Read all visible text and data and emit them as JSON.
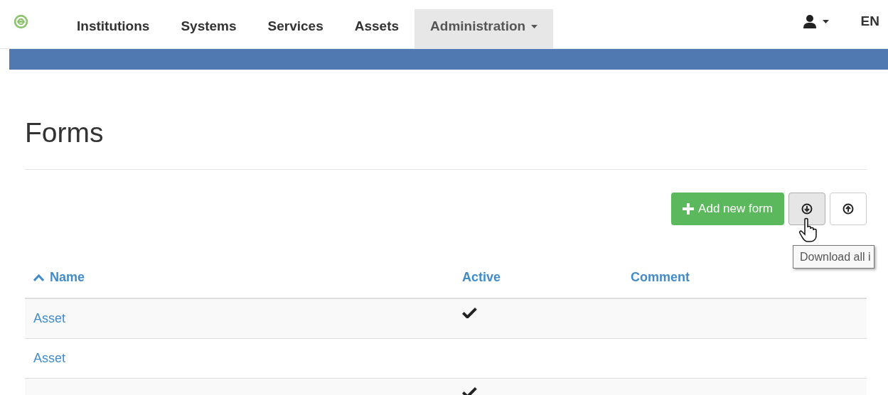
{
  "nav": {
    "items": [
      {
        "label": "Institutions",
        "selected": false,
        "dropdown": false
      },
      {
        "label": "Systems",
        "selected": false,
        "dropdown": false
      },
      {
        "label": "Services",
        "selected": false,
        "dropdown": false
      },
      {
        "label": "Assets",
        "selected": false,
        "dropdown": false
      },
      {
        "label": "Administration",
        "selected": true,
        "dropdown": true
      }
    ],
    "language": "EN"
  },
  "page": {
    "title": "Forms"
  },
  "toolbar": {
    "add_button": "Add new form",
    "tooltip": "Download all i"
  },
  "table": {
    "columns": [
      {
        "label": "Name",
        "sorted": true
      },
      {
        "label": "Active",
        "sorted": false
      },
      {
        "label": "Comment",
        "sorted": false
      }
    ],
    "rows": [
      {
        "name": "Asset",
        "active": true
      },
      {
        "name": "Asset",
        "active": false
      },
      {
        "active": true
      }
    ]
  }
}
